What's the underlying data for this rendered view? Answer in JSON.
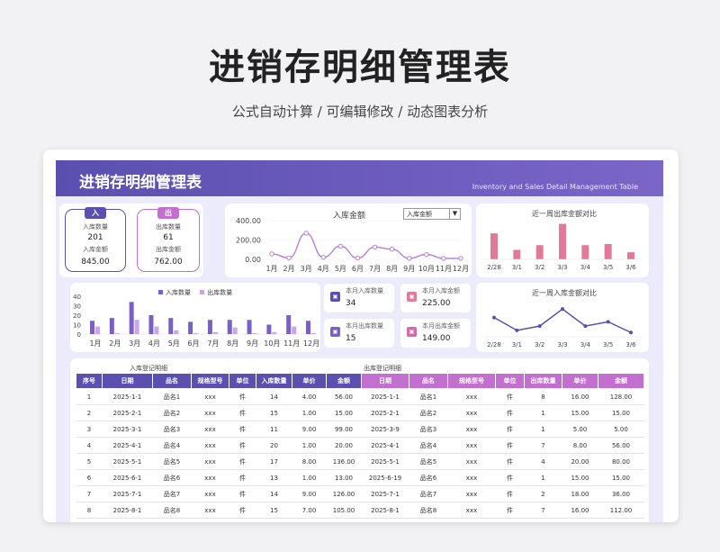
{
  "header": {
    "title": "进销存明细管理表",
    "subtitle": "公式自动计算 / 可编辑修改 / 动态图表分析"
  },
  "banner": {
    "title": "进销存明细管理表",
    "english": "Inventory and Sales Detail Management Table"
  },
  "in_box": {
    "tag": "入",
    "qty_label": "入库数量",
    "qty": "201",
    "amt_label": "入库金额",
    "amt": "845.00"
  },
  "out_box": {
    "tag": "出",
    "qty_label": "出库数量",
    "qty": "61",
    "amt_label": "出库金额",
    "amt": "762.00"
  },
  "stats": {
    "month_in_qty_label": "本月入库数量",
    "month_in_qty": "34",
    "month_in_amt_label": "本月入库金额",
    "month_in_amt": "225.00",
    "month_out_qty_label": "本月出库数量",
    "month_out_qty": "15",
    "month_out_amt_label": "本月出库金额",
    "month_out_amt": "149.00"
  },
  "dropdown": {
    "value": "入库金额"
  },
  "colors": {
    "purple": "#5b4fb0",
    "magenta": "#c36fd0",
    "pink": "#e07a98",
    "bar_light": "#c9a6e6"
  },
  "chart_data": [
    {
      "type": "line",
      "title": "入库金额",
      "categories": [
        "1月",
        "2月",
        "3月",
        "4月",
        "5月",
        "6月",
        "7月",
        "8月",
        "9月",
        "10月",
        "11月",
        "12月"
      ],
      "values": [
        56,
        15,
        270,
        20,
        136,
        13,
        126,
        105,
        10,
        50,
        10,
        10
      ],
      "yticks": [
        "400.00",
        "200.00",
        "0.00"
      ],
      "ylim": [
        0,
        400
      ]
    },
    {
      "type": "bar",
      "title": "近一周出库金额对比",
      "categories": [
        "2/28",
        "3/1",
        "3/2",
        "3/3",
        "3/4",
        "3/5",
        "3/6"
      ],
      "values": [
        110,
        40,
        60,
        150,
        60,
        65,
        30
      ],
      "ylim": [
        0,
        160
      ]
    },
    {
      "type": "bar",
      "legend": [
        "入库数量",
        "出库数量"
      ],
      "categories": [
        "1月",
        "2月",
        "3月",
        "4月",
        "5月",
        "6月",
        "7月",
        "8月",
        "9月",
        "10月",
        "11月",
        "12月"
      ],
      "yticks": [
        "40",
        "30",
        "20",
        "10",
        "0"
      ],
      "ylim": [
        0,
        40
      ],
      "series": [
        {
          "name": "入库数量",
          "values": [
            14,
            17,
            34,
            20,
            17,
            13,
            15,
            15,
            15,
            10,
            20,
            14
          ]
        },
        {
          "name": "出库数量",
          "values": [
            8,
            1,
            15,
            8,
            4,
            1,
            2,
            7,
            1,
            2,
            8,
            1
          ]
        }
      ]
    },
    {
      "type": "line",
      "title": "近一周入库金额对比",
      "categories": [
        "2/28",
        "3/1",
        "3/2",
        "3/3",
        "3/4",
        "3/5",
        "3/6"
      ],
      "values": [
        45,
        15,
        25,
        65,
        25,
        35,
        10
      ],
      "ylim": [
        0,
        80
      ]
    }
  ],
  "in_table": {
    "section_label": "入库登记明细",
    "headers": [
      "序号",
      "日期",
      "品名",
      "规格型号",
      "单位",
      "入库数量",
      "单价",
      "金额"
    ],
    "rows": [
      [
        "1",
        "2025-1-1",
        "品名1",
        "xxx",
        "件",
        "14",
        "4.00",
        "56.00"
      ],
      [
        "2",
        "2025-2-1",
        "品名2",
        "xxx",
        "件",
        "15",
        "1.00",
        "15.00"
      ],
      [
        "3",
        "2025-3-1",
        "品名3",
        "xxx",
        "件",
        "11",
        "9.00",
        "99.00"
      ],
      [
        "4",
        "2025-4-1",
        "品名4",
        "xxx",
        "件",
        "20",
        "1.00",
        "20.00"
      ],
      [
        "5",
        "2025-5-1",
        "品名5",
        "xxx",
        "件",
        "17",
        "8.00",
        "136.00"
      ],
      [
        "6",
        "2025-6-1",
        "品名6",
        "xxx",
        "件",
        "13",
        "1.00",
        "13.00"
      ],
      [
        "7",
        "2025-7-1",
        "品名7",
        "xxx",
        "件",
        "14",
        "9.00",
        "126.00"
      ],
      [
        "8",
        "2025-8-1",
        "品名8",
        "xxx",
        "件",
        "15",
        "7.00",
        "105.00"
      ]
    ]
  },
  "out_table": {
    "section_label": "出库登记明细",
    "headers": [
      "日期",
      "品名",
      "规格型号",
      "单位",
      "出库数量",
      "单价",
      "金额"
    ],
    "rows": [
      [
        "2025-1-1",
        "品名1",
        "xxx",
        "件",
        "8",
        "16.00",
        "128.00"
      ],
      [
        "2025-2-1",
        "品名2",
        "xxx",
        "件",
        "1",
        "15.00",
        "15.00"
      ],
      [
        "2025-3-9",
        "品名3",
        "xxx",
        "件",
        "1",
        "5.00",
        "5.00"
      ],
      [
        "2025-4-1",
        "品名4",
        "xxx",
        "件",
        "7",
        "8.00",
        "56.00"
      ],
      [
        "2025-5-1",
        "品名5",
        "xxx",
        "件",
        "4",
        "20.00",
        "80.00"
      ],
      [
        "2025-6-19",
        "品名6",
        "xxx",
        "件",
        "1",
        "15.00",
        "15.00"
      ],
      [
        "2025-7-1",
        "品名7",
        "xxx",
        "件",
        "2",
        "18.00",
        "36.00"
      ],
      [
        "2025-8-1",
        "品名8",
        "xxx",
        "件",
        "7",
        "16.00",
        "112.00"
      ]
    ]
  }
}
